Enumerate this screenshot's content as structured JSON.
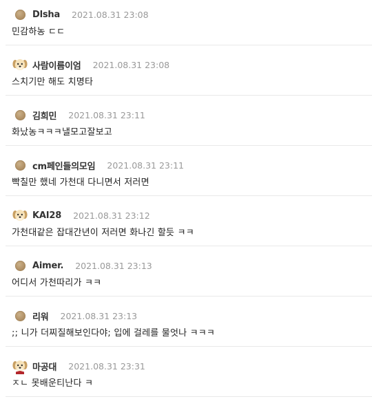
{
  "comments": [
    {
      "nick": "Dlsha",
      "date": "2021.08.31 23:08",
      "text": "민감하농 ㄷㄷ",
      "avatar": "bronze-dot-icon"
    },
    {
      "nick": "사람이름이엄",
      "date": "2021.08.31 23:08",
      "text": "스치기만 해도 치명타",
      "avatar": "dog-icon"
    },
    {
      "nick": "김희민",
      "date": "2021.08.31 23:11",
      "text": "화났농ㅋㅋㅋ낼모고잘보고",
      "avatar": "bronze-dot-icon"
    },
    {
      "nick": "cm페인들의모임",
      "date": "2021.08.31 23:11",
      "text": "빡칠만 했네 가천대 다니면서 저러면",
      "avatar": "bronze-dot-icon"
    },
    {
      "nick": "KAI28",
      "date": "2021.08.31 23:12",
      "text": "가천대같은 잡대간년이 저러면 화나긴 할듯 ㅋㅋ",
      "avatar": "dog-icon"
    },
    {
      "nick": "Aimer.",
      "date": "2021.08.31 23:13",
      "text": "어디서 가천따리가 ㅋㅋ",
      "avatar": "bronze-dot-icon"
    },
    {
      "nick": "리워",
      "date": "2021.08.31 23:13",
      "text": ";; 니가 더찌질해보인다야; 입에 걸레를 물엇나 ㅋㅋㅋ",
      "avatar": "bronze-dot-icon"
    },
    {
      "nick": "마공대",
      "date": "2021.08.31 23:31",
      "text": "ㅈㄴ 못배운티난다 ㅋ",
      "avatar": "dog-icon"
    }
  ]
}
